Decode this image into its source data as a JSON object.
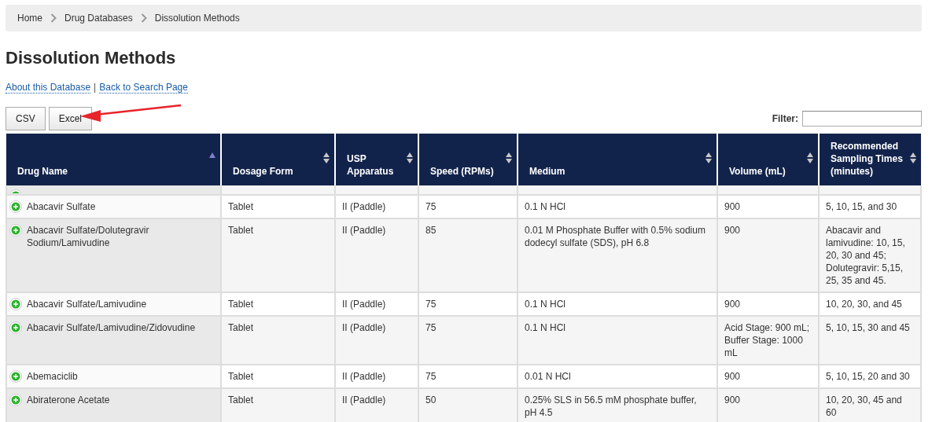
{
  "breadcrumb": [
    {
      "label": "Home"
    },
    {
      "label": "Drug Databases"
    },
    {
      "label": "Dissolution Methods"
    }
  ],
  "title": "Dissolution Methods",
  "links": [
    {
      "label": "About this Database"
    },
    {
      "label": "Back to Search Page"
    }
  ],
  "link_separator": "|",
  "export_buttons": [
    {
      "label": "CSV"
    },
    {
      "label": "Excel"
    }
  ],
  "annotation": {
    "kind": "arrow"
  },
  "filter": {
    "label": "Filter:"
  },
  "table": {
    "columns": [
      {
        "label": "Drug Name",
        "sorted_ascending": true
      },
      {
        "label": "Dosage Form",
        "sorted_ascending": false
      },
      {
        "label": "USP Apparatus",
        "sorted_ascending": false
      },
      {
        "label": "Speed (RPMs)",
        "sorted_ascending": false
      },
      {
        "label": "Medium",
        "sorted_ascending": false
      },
      {
        "label": "Volume (mL)",
        "sorted_ascending": false
      },
      {
        "label": "Recommended Sampling Times (minutes)",
        "sorted_ascending": false
      }
    ],
    "rows": [
      {
        "kind": "partial"
      },
      {
        "kind": "full",
        "cells": [
          "Abacavir Sulfate",
          "Tablet",
          "II (Paddle)",
          "75",
          "0.1 N HCl",
          "900",
          "5, 10, 15, and 30"
        ]
      },
      {
        "kind": "full",
        "cells": [
          "Abacavir Sulfate/Dolutegravir Sodium/Lamivudine",
          "Tablet",
          "II (Paddle)",
          "85",
          "0.01 M Phosphate Buffer with 0.5% sodium dodecyl sulfate (SDS), pH 6.8",
          "900",
          "Abacavir and lamivudine: 10, 15, 20, 30 and 45; Dolutegravir: 5,15, 25, 35 and 45."
        ]
      },
      {
        "kind": "full",
        "cells": [
          "Abacavir Sulfate/Lamivudine",
          "Tablet",
          "II (Paddle)",
          "75",
          "0.1 N HCl",
          "900",
          "10, 20, 30, and 45"
        ]
      },
      {
        "kind": "full",
        "cells": [
          "Abacavir Sulfate/Lamivudine/Zidovudine",
          "Tablet",
          "II (Paddle)",
          "75",
          "0.1 N HCl",
          "Acid Stage: 900 mL; Buffer Stage: 1000 mL",
          "5, 10, 15, 30 and 45"
        ]
      },
      {
        "kind": "full",
        "cells": [
          "Abemaciclib",
          "Tablet",
          "II (Paddle)",
          "75",
          "0.01 N HCl",
          "900",
          "5, 10, 15, 20 and 30"
        ]
      },
      {
        "kind": "full",
        "cells": [
          "Abiraterone Acetate",
          "Tablet",
          "II (Paddle)",
          "50",
          "0.25% SLS in 56.5 mM phosphate buffer, pH 4.5",
          "900",
          "10, 20, 30, 45 and 60"
        ]
      }
    ]
  }
}
